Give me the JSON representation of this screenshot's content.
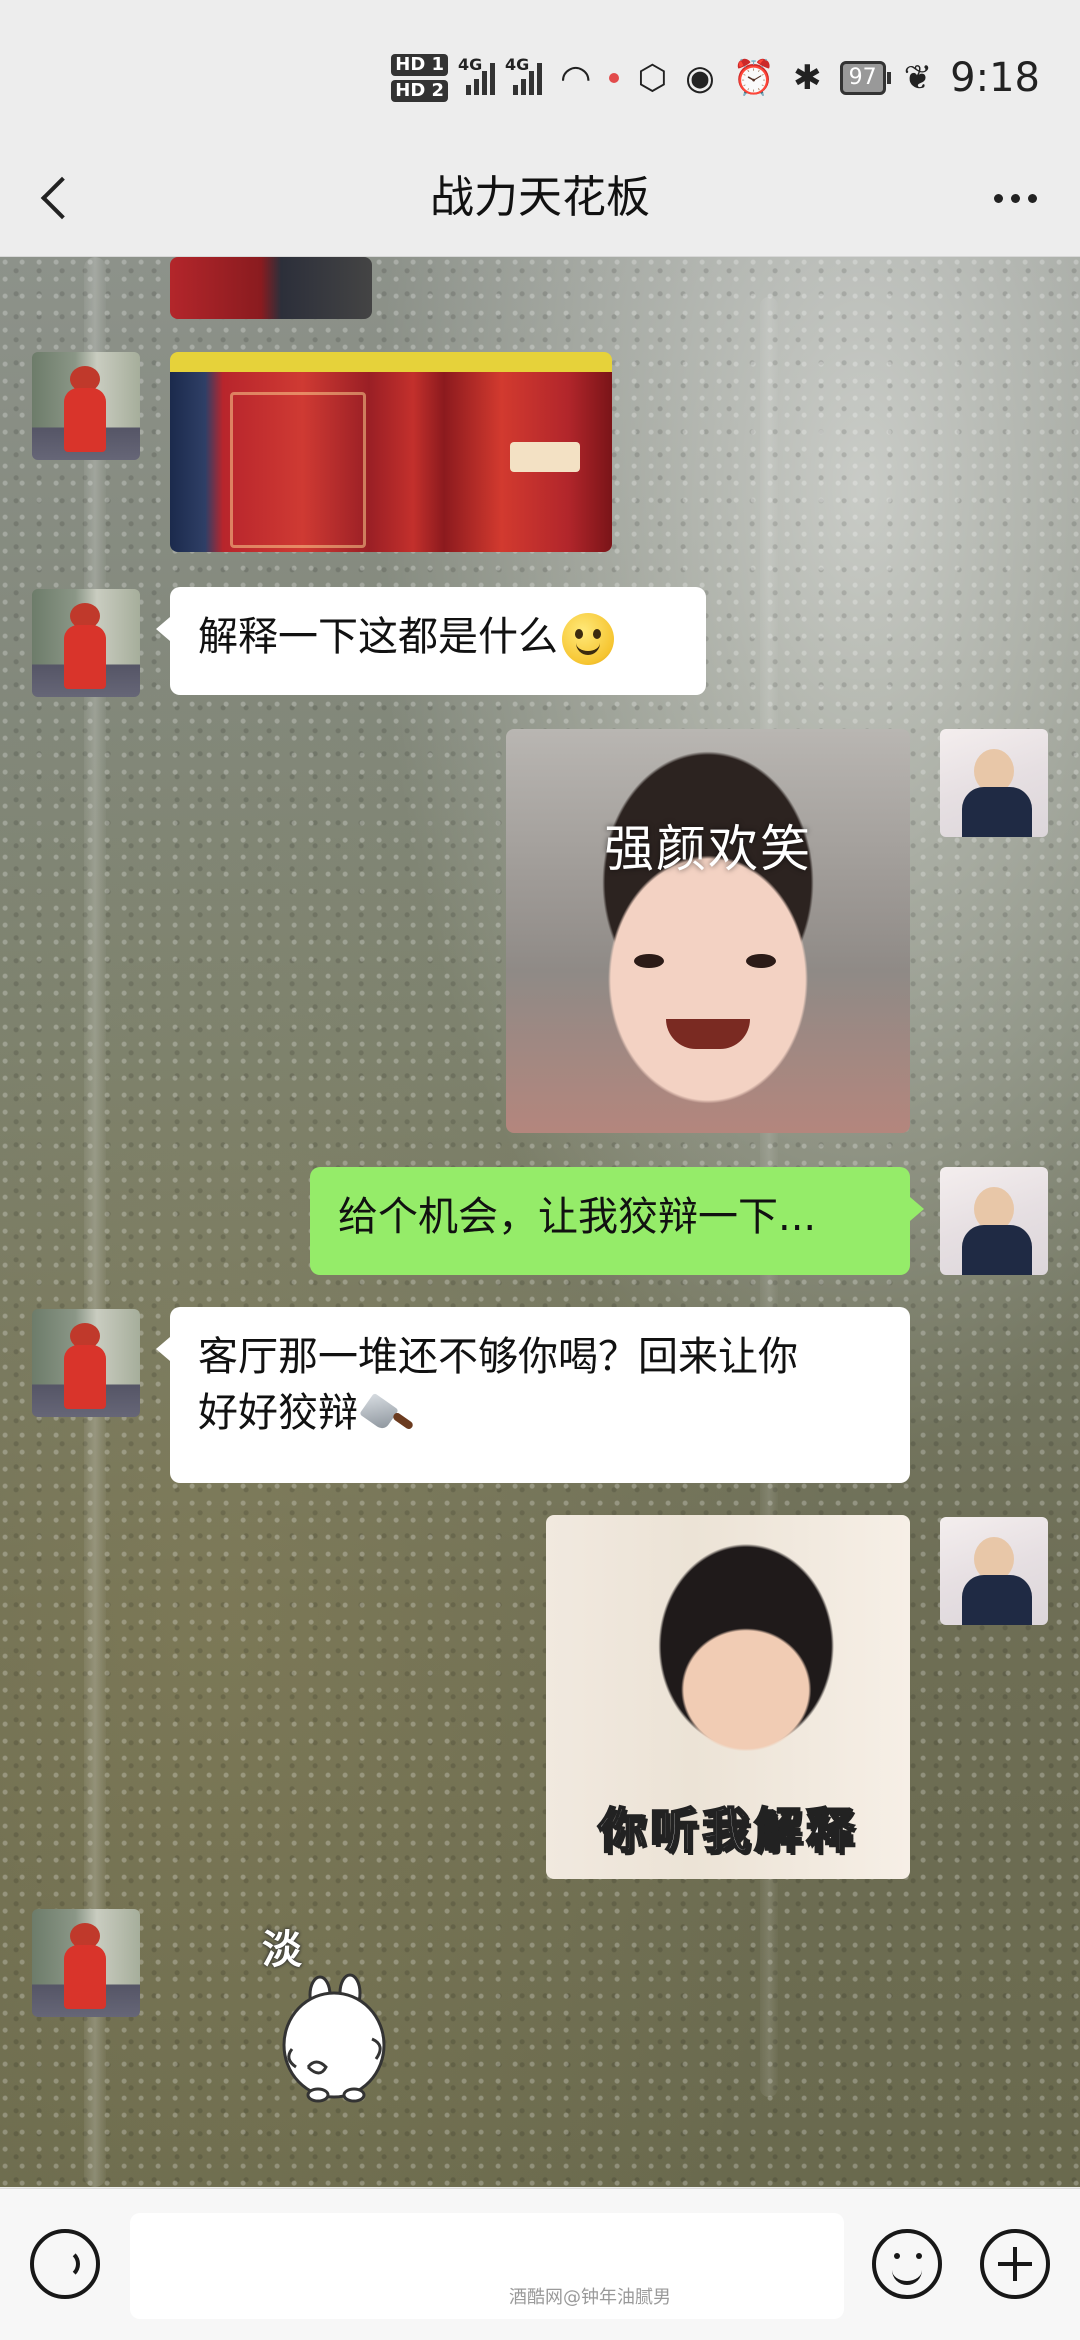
{
  "status_bar": {
    "hd1": "HD 1",
    "hd2": "HD 2",
    "net1": "4G",
    "net2": "4G",
    "battery": "97",
    "time": "9:18"
  },
  "header": {
    "title": "战力天花板"
  },
  "messages": [
    {
      "from": "friend",
      "type": "image",
      "desc": "partial-photo"
    },
    {
      "from": "friend",
      "type": "image",
      "desc": "gift-boxes-photo"
    },
    {
      "from": "friend",
      "type": "text",
      "text": "解释一下这都是什么",
      "emoji": "smile-emoji"
    },
    {
      "from": "self",
      "type": "sticker",
      "caption": "强颜欢笑"
    },
    {
      "from": "self",
      "type": "text",
      "text": "给个机会，让我狡辩一下..."
    },
    {
      "from": "friend",
      "type": "text",
      "line1": "客厅那一堆还不够你喝？回来让你",
      "line2": "好好狡辩",
      "emoji": "cleaver-emoji"
    },
    {
      "from": "self",
      "type": "sticker",
      "caption": "你听我解释"
    },
    {
      "from": "friend",
      "type": "sticker",
      "caption": "淡"
    }
  ],
  "input_bar": {
    "placeholder": "",
    "watermark": "酒酷网@钟年油腻男"
  },
  "colors": {
    "bubble_out": "#95ec69",
    "bubble_in": "#ffffff",
    "bar_bg": "#ededed"
  }
}
